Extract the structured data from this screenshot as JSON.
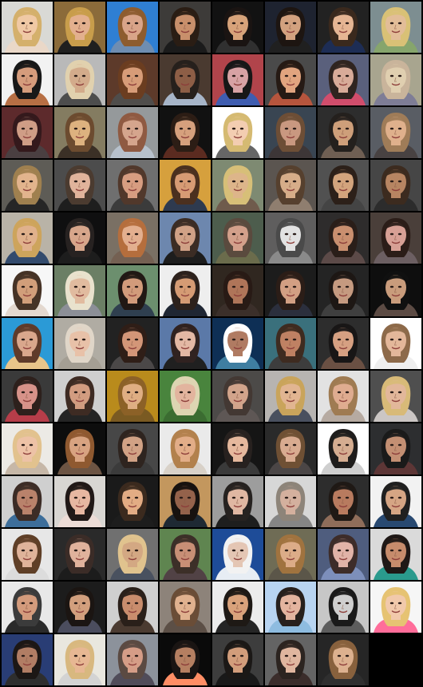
{
  "image": {
    "description_kind": "generated face sample grid",
    "rows": 13,
    "cols": 8,
    "total_tiles": 104,
    "filled_tiles": 103,
    "background_color": "#000000"
  },
  "tiles": [
    {
      "bg": "#d9d9d5",
      "skin": "#f0c9a5",
      "hair": "#d4b06c",
      "shirt": "#ead8c8"
    },
    {
      "bg": "#8b6b3a",
      "skin": "#e3b08e",
      "hair": "#c89d4b",
      "shirt": "#1f1f1f"
    },
    {
      "bg": "#2f7fd3",
      "skin": "#d9a489",
      "hair": "#8d5c2f",
      "shirt": "#6f8db1"
    },
    {
      "bg": "#3d3b39",
      "skin": "#c88f6b",
      "hair": "#2a1d14",
      "shirt": "#1b1b1b"
    },
    {
      "bg": "#121212",
      "skin": "#d7a37a",
      "hair": "#1a1412",
      "shirt": "#303030"
    },
    {
      "bg": "#1e2330",
      "skin": "#d2a17f",
      "hair": "#1d1511",
      "shirt": "#202020"
    },
    {
      "bg": "#222222",
      "skin": "#e5b593",
      "hair": "#3a291d",
      "shirt": "#1d2d55"
    },
    {
      "bg": "#7d8e91",
      "skin": "#e2bd98",
      "hair": "#d9c176",
      "shirt": "#86a56c"
    },
    {
      "bg": "#f2f2f2",
      "skin": "#d59c7c",
      "hair": "#181818",
      "shirt": "#b76f44"
    },
    {
      "bg": "#b9b9b9",
      "skin": "#d3ab8b",
      "hair": "#e1d1ae",
      "shirt": "#4d4d4d"
    },
    {
      "bg": "#5d3a2a",
      "skin": "#d79c78",
      "hair": "#6b3d20",
      "shirt": "#4f4d4b"
    },
    {
      "bg": "#4a3a30",
      "skin": "#8d5e46",
      "hair": "#26201c",
      "shirt": "#a7b5c8"
    },
    {
      "bg": "#b1444b",
      "skin": "#d7a2a4",
      "hair": "#171717",
      "shirt": "#3f5db0"
    },
    {
      "bg": "#4a4a4a",
      "skin": "#e1a47f",
      "hair": "#261a14",
      "shirt": "#b6553d"
    },
    {
      "bg": "#5a607c",
      "skin": "#d8ab99",
      "hair": "#2f2420",
      "shirt": "#d14d6c"
    },
    {
      "bg": "#a8a58f",
      "skin": "#e0cfb0",
      "hair": "#c9b49b",
      "shirt": "#7e7d96"
    },
    {
      "bg": "#5d2a2c",
      "skin": "#cf9d86",
      "hair": "#34191c",
      "shirt": "#4a3f41"
    },
    {
      "bg": "#847c61",
      "skin": "#ddb27f",
      "hair": "#6c4b2f",
      "shirt": "#3b3026"
    },
    {
      "bg": "#95999b",
      "skin": "#d5a58d",
      "hair": "#8f5a42",
      "shirt": "#b7c1cc"
    },
    {
      "bg": "#111111",
      "skin": "#d6a07d",
      "hair": "#2c1d15",
      "shirt": "#5b2b20"
    },
    {
      "bg": "#ffffff",
      "skin": "#f3cdb1",
      "hair": "#d5ba72",
      "shirt": "#666666"
    },
    {
      "bg": "#394552",
      "skin": "#c99880",
      "hair": "#6d4e36",
      "shirt": "#3d3637"
    },
    {
      "bg": "#2d2d2d",
      "skin": "#ce9f7a",
      "hair": "#24201d",
      "shirt": "#6f5f53"
    },
    {
      "bg": "#595d64",
      "skin": "#dfb08c",
      "hair": "#9f7c58",
      "shirt": "#484242"
    },
    {
      "bg": "#5e5c56",
      "skin": "#e2b48d",
      "hair": "#9f804f",
      "shirt": "#262626"
    },
    {
      "bg": "#4c4c4c",
      "skin": "#e0b39b",
      "hair": "#4b3b30",
      "shirt": "#1e1e1e"
    },
    {
      "bg": "#6f6f6f",
      "skin": "#d79d81",
      "hair": "#51382b",
      "shirt": "#3b3b3b"
    },
    {
      "bg": "#d6a03d",
      "skin": "#d79b74",
      "hair": "#4b301f",
      "shirt": "#2e3a4f"
    },
    {
      "bg": "#7e8a72",
      "skin": "#ddb58a",
      "hair": "#d7bf78",
      "shirt": "#6f5b4c"
    },
    {
      "bg": "#5b5550",
      "skin": "#d6ad89",
      "hair": "#56402e",
      "shirt": "#8f7e6f"
    },
    {
      "bg": "#515151",
      "skin": "#d3a47d",
      "hair": "#2c2019",
      "shirt": "#444444"
    },
    {
      "bg": "#464646",
      "skin": "#b78562",
      "hair": "#3c2b1f",
      "shirt": "#2c2c2c"
    },
    {
      "bg": "#b9b3a7",
      "skin": "#e0b18c",
      "hair": "#cda45c",
      "shirt": "#334b6d"
    },
    {
      "bg": "#0f0f10",
      "skin": "#d7a68b",
      "hair": "#272221",
      "shirt": "#1d1d1d"
    },
    {
      "bg": "#7a7064",
      "skin": "#e3af8f",
      "hair": "#b56e3d",
      "shirt": "#746052"
    },
    {
      "bg": "#6d87ae",
      "skin": "#d0a186",
      "hair": "#3b2c24",
      "shirt": "#1d1d1d"
    },
    {
      "bg": "#4d5d4d",
      "skin": "#d3a08b",
      "hair": "#5a4a3e",
      "shirt": "#6b6c4c"
    },
    {
      "bg": "#5f5e5e",
      "skin": "#e2e2e2",
      "hair": "#4a4a4a",
      "shirt": "#8a8a8a"
    },
    {
      "bg": "#2e2c2c",
      "skin": "#c98f6f",
      "hair": "#2a1e19",
      "shirt": "#5c4a48"
    },
    {
      "bg": "#4a3f3a",
      "skin": "#d7a095",
      "hair": "#2b1d18",
      "shirt": "#6c5f62"
    },
    {
      "bg": "#f7f7f7",
      "skin": "#d19e7a",
      "hair": "#463326",
      "shirt": "#e3d8cf"
    },
    {
      "bg": "#6b7f65",
      "skin": "#e1bb9f",
      "hair": "#e9e2cd",
      "shirt": "#8c8f97"
    },
    {
      "bg": "#6c8f6e",
      "skin": "#d29b7b",
      "hair": "#211814",
      "shirt": "#2f3f4f"
    },
    {
      "bg": "#eeeeee",
      "skin": "#d59b74",
      "hair": "#2c211c",
      "shirt": "#1f2633"
    },
    {
      "bg": "#302720",
      "skin": "#af7559",
      "hair": "#281a15",
      "shirt": "#3b2f2a"
    },
    {
      "bg": "#1c1c1c",
      "skin": "#d29f83",
      "hair": "#2b1d17",
      "shirt": "#2b2f3d"
    },
    {
      "bg": "#242424",
      "skin": "#c59a80",
      "hair": "#1d1714",
      "shirt": "#3f3f3f"
    },
    {
      "bg": "#0e0e0e",
      "skin": "#c99c7c",
      "hair": "#101010",
      "shirt": "#5c4b44"
    },
    {
      "bg": "#2b9ad6",
      "skin": "#d9a78c",
      "hair": "#5f3b2a",
      "shirt": "#e8c58a"
    },
    {
      "bg": "#b0aca3",
      "skin": "#e8c1a8",
      "hair": "#e0d6c8",
      "shirt": "#a49e93"
    },
    {
      "bg": "#222222",
      "skin": "#d39678",
      "hair": "#2f1e17",
      "shirt": "#4b4848"
    },
    {
      "bg": "#5b79a8",
      "skin": "#e3b8a4",
      "hair": "#302220",
      "shirt": "#202020"
    },
    {
      "bg": "#0e2f55",
      "skin": "#b07b62",
      "hair": "#ffffff",
      "shirt": "#3f7ea1"
    },
    {
      "bg": "#3a707c",
      "skin": "#bf8163",
      "hair": "#3e2b20",
      "shirt": "#3d3d3d"
    },
    {
      "bg": "#2d2d2d",
      "skin": "#d6a082",
      "hair": "#181616",
      "shirt": "#6a5043"
    },
    {
      "bg": "#ffffff",
      "skin": "#e3b79a",
      "hair": "#8d6a4a",
      "shirt": "#efefef"
    },
    {
      "bg": "#3a3a3a",
      "skin": "#d79289",
      "hair": "#2d201c",
      "shirt": "#b63d49"
    },
    {
      "bg": "#cfcfcf",
      "skin": "#d29c80",
      "hair": "#3e2b23",
      "shirt": "#242424"
    },
    {
      "bg": "#b98b1c",
      "skin": "#dfae83",
      "hair": "#8c6127",
      "shirt": "#7a5a22"
    },
    {
      "bg": "#49843d",
      "skin": "#e2b49e",
      "hair": "#ddd5b2",
      "shirt": "#3b6c31"
    },
    {
      "bg": "#4c4a48",
      "skin": "#d2a48b",
      "hair": "#433833",
      "shirt": "#5e5755"
    },
    {
      "bg": "#b7b4b1",
      "skin": "#e1b591",
      "hair": "#c9a45b",
      "shirt": "#49505e"
    },
    {
      "bg": "#e2e2e2",
      "skin": "#dfac90",
      "hair": "#9f7b52",
      "shirt": "#b6aaa1"
    },
    {
      "bg": "#4f4f4f",
      "skin": "#e2b79a",
      "hair": "#d8ba78",
      "shirt": "#cbc6c4"
    },
    {
      "bg": "#eceae5",
      "skin": "#edc2a6",
      "hair": "#e2c28e",
      "shirt": "#c6b7a7"
    },
    {
      "bg": "#0d0d0d",
      "skin": "#d8a381",
      "hair": "#8f5930",
      "shirt": "#6c5443"
    },
    {
      "bg": "#474747",
      "skin": "#d1a285",
      "hair": "#2e241f",
      "shirt": "#3b3b3b"
    },
    {
      "bg": "#eaeaea",
      "skin": "#e2ad88",
      "hair": "#b2814d",
      "shirt": "#d8d1c8"
    },
    {
      "bg": "#151515",
      "skin": "#e5b89d",
      "hair": "#27211f",
      "shirt": "#3a3a3a"
    },
    {
      "bg": "#2a2a2a",
      "skin": "#d8ab90",
      "hair": "#6f5034",
      "shirt": "#4b4646"
    },
    {
      "bg": "#ffffff",
      "skin": "#d5ad91",
      "hair": "#1f1d1c",
      "shirt": "#cfcfcf"
    },
    {
      "bg": "#2d2e30",
      "skin": "#c38f73",
      "hair": "#1a1a1a",
      "shirt": "#5d3636"
    },
    {
      "bg": "#cfcfcf",
      "skin": "#b9826b",
      "hair": "#3c2c26",
      "shirt": "#3d6e9a"
    },
    {
      "bg": "#d8d6d2",
      "skin": "#e7b7a1",
      "hair": "#211917",
      "shirt": "#ecdcd6"
    },
    {
      "bg": "#1a1a1a",
      "skin": "#e3ac84",
      "hair": "#3b2a1e",
      "shirt": "#1d1d1d"
    },
    {
      "bg": "#c3975e",
      "skin": "#94624b",
      "hair": "#17120f",
      "shirt": "#1e2933"
    },
    {
      "bg": "#9d9d9d",
      "skin": "#e0b7a2",
      "hair": "#262220",
      "shirt": "#1e1e1e"
    },
    {
      "bg": "#d7d7d7",
      "skin": "#d4b09e",
      "hair": "#8d8479",
      "shirt": "#858585"
    },
    {
      "bg": "#2d2d2d",
      "skin": "#b87b5f",
      "hair": "#1f1915",
      "shirt": "#8f6d5a"
    },
    {
      "bg": "#f2f2f2",
      "skin": "#d5a584",
      "hair": "#202020",
      "shirt": "#284971"
    },
    {
      "bg": "#e7e7e7",
      "skin": "#dfb39a",
      "hair": "#5f3f27",
      "shirt": "#dcdcdc"
    },
    {
      "bg": "#2a2a2a",
      "skin": "#e0b29c",
      "hair": "#3b2c27",
      "shirt": "#1c1c1c"
    },
    {
      "bg": "#707070",
      "skin": "#d3a883",
      "hair": "#e0c38e",
      "shirt": "#49515f"
    },
    {
      "bg": "#5f8550",
      "skin": "#c88f76",
      "hair": "#3c2f28",
      "shirt": "#514245"
    },
    {
      "bg": "#1e4c98",
      "skin": "#e4c6b4",
      "hair": "#f2f2f2",
      "shirt": "#e7edf4"
    },
    {
      "bg": "#6f6c55",
      "skin": "#dcac88",
      "hair": "#a0733f",
      "shirt": "#5b5649"
    },
    {
      "bg": "#4f5d7e",
      "skin": "#e1b3a8",
      "hair": "#3d2c29",
      "shirt": "#7d8fbb"
    },
    {
      "bg": "#dadada",
      "skin": "#c78c6c",
      "hair": "#1f1816",
      "shirt": "#2a9a8d"
    },
    {
      "bg": "#e8e8e8",
      "skin": "#d39b7c",
      "hair": "#3b3b3b",
      "shirt": "#2a2a2a"
    },
    {
      "bg": "#1c1c1c",
      "skin": "#d29f7d",
      "hair": "#1b1512",
      "shirt": "#4b4d5e"
    },
    {
      "bg": "#cfcfcf",
      "skin": "#c98d6d",
      "hair": "#2a201a",
      "shirt": "#4b3b31"
    },
    {
      "bg": "#8d837a",
      "skin": "#e0b18f",
      "hair": "#6a4d37",
      "shirt": "#5c4f46"
    },
    {
      "bg": "#ececec",
      "skin": "#d9a27b",
      "hair": "#1e1915",
      "shirt": "#252525"
    },
    {
      "bg": "#b8d4f1",
      "skin": "#e3b49f",
      "hair": "#27201d",
      "shirt": "#8ebce0"
    },
    {
      "bg": "#c7c7c7",
      "skin": "#cfcfcf",
      "hair": "#1a1a1a",
      "shirt": "#5d5d5d"
    },
    {
      "bg": "#f6f6f6",
      "skin": "#f1c9ab",
      "hair": "#e6c373",
      "shirt": "#ff6d9a"
    },
    {
      "bg": "#293d75",
      "skin": "#b17d64",
      "hair": "#1c1715",
      "shirt": "#2e2e2e"
    },
    {
      "bg": "#e9e7df",
      "skin": "#e7b793",
      "hair": "#d8b87f",
      "shirt": "#d3d3d3"
    },
    {
      "bg": "#8c929b",
      "skin": "#d59d87",
      "hair": "#5b4a42",
      "shirt": "#504c59"
    },
    {
      "bg": "#0a0a0a",
      "skin": "#b57f61",
      "hair": "#1a1513",
      "shirt": "#ff8e65"
    },
    {
      "bg": "#3d3d3d",
      "skin": "#d29d7b",
      "hair": "#1b1816",
      "shirt": "#191919"
    },
    {
      "bg": "#646464",
      "skin": "#e0b69f",
      "hair": "#2c2420",
      "shirt": "#3b2d2b"
    },
    {
      "bg": "#262626",
      "skin": "#ddb18f",
      "hair": "#88613d",
      "shirt": "#2f2f2f"
    }
  ]
}
